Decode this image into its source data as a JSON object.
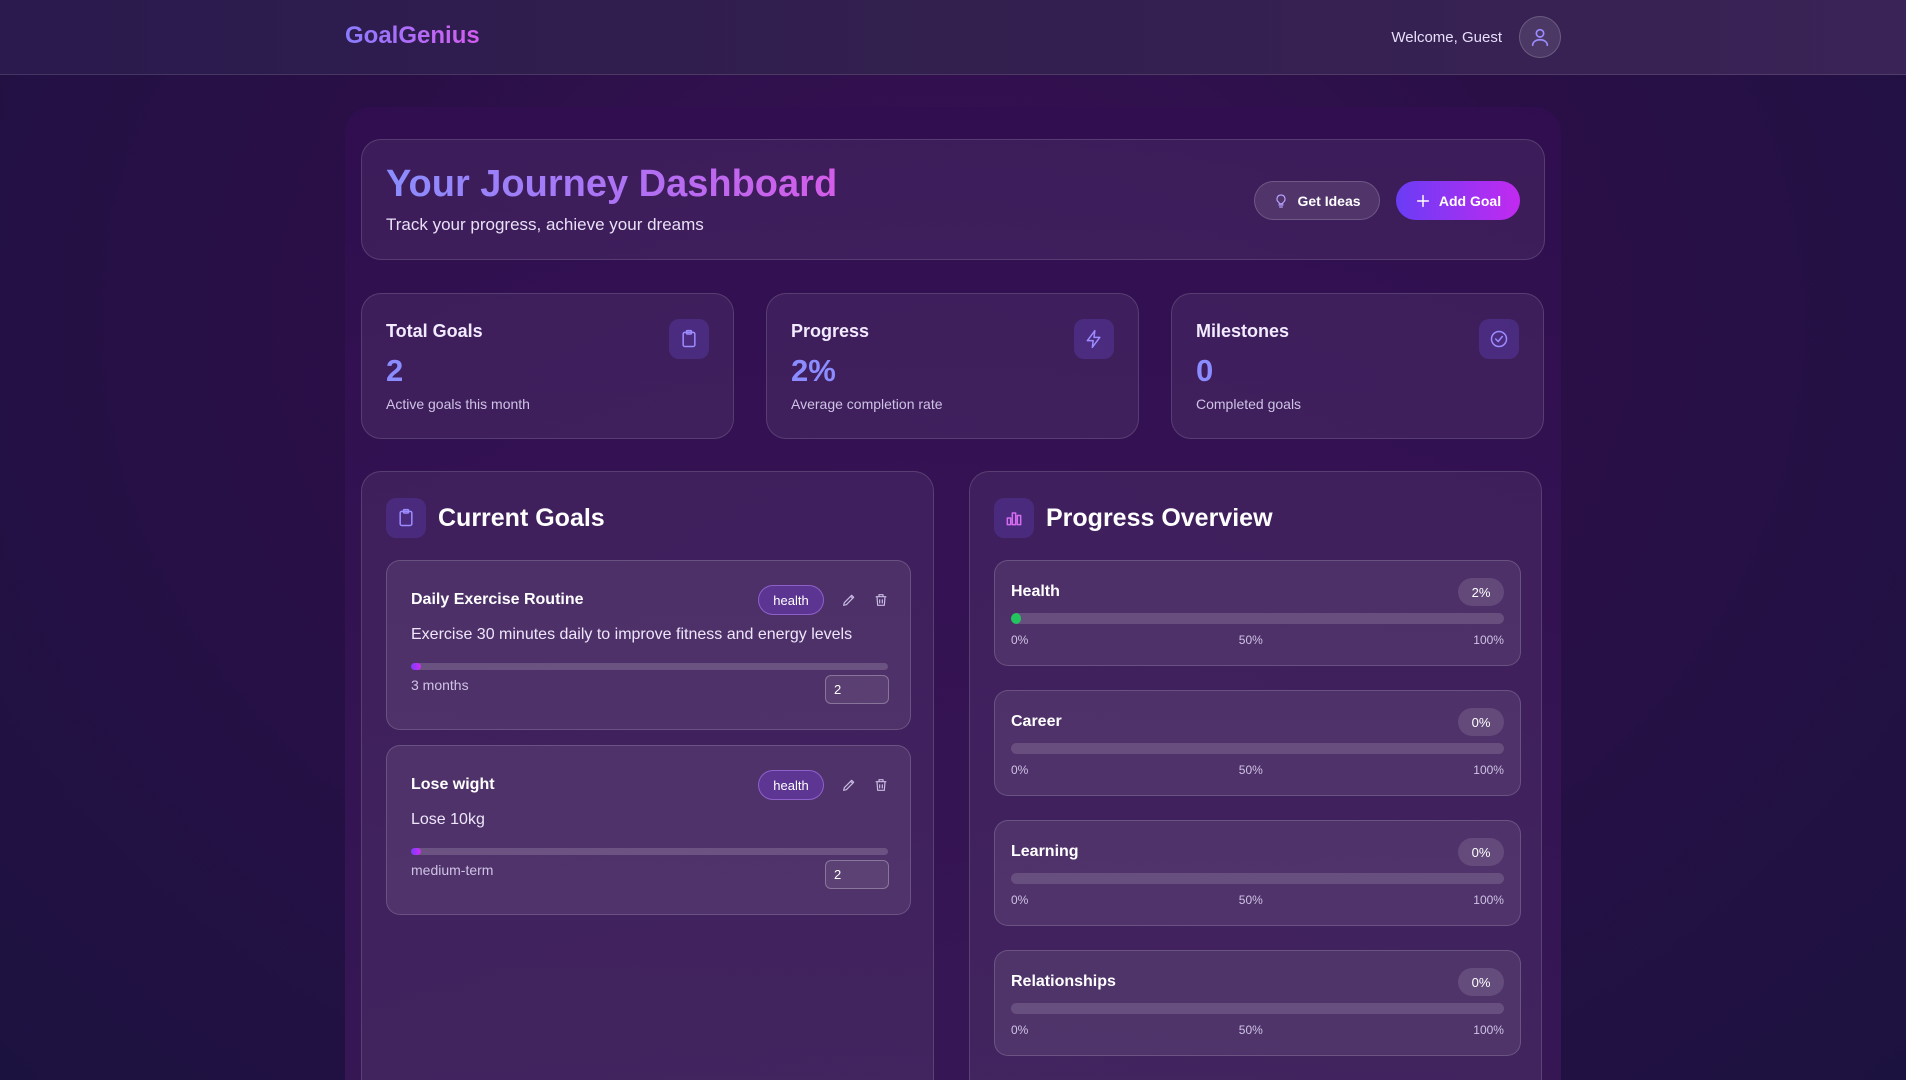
{
  "header": {
    "brand": "GoalGenius",
    "welcome": "Welcome, Guest",
    "avatar_icon": "user-icon"
  },
  "hero": {
    "title": "Your Journey Dashboard",
    "subtitle": "Track your progress, achieve your dreams",
    "ideas_label": "Get Ideas",
    "add_label": "Add Goal"
  },
  "stats": [
    {
      "title": "Total Goals",
      "value": "2",
      "note": "Active goals this month",
      "icon": "clipboard-icon"
    },
    {
      "title": "Progress",
      "value": "2%",
      "note": "Average completion rate",
      "icon": "lightning-icon"
    },
    {
      "title": "Milestones",
      "value": "0",
      "note": "Completed goals",
      "icon": "check-circle-icon"
    }
  ],
  "current_goals": {
    "title": "Current Goals",
    "icon": "clipboard-icon",
    "goals": [
      {
        "title": "Daily Exercise Routine",
        "tag": "health",
        "description": "Exercise 30 minutes daily to improve fitness and energy levels",
        "term": "3 months",
        "progress_value": "2",
        "progress_fraction": 0.02
      },
      {
        "title": "Lose wight",
        "tag": "health",
        "description": "Lose 10kg",
        "term": "medium-term",
        "progress_value": "2",
        "progress_fraction": 0.02
      }
    ]
  },
  "progress_overview": {
    "title": "Progress Overview",
    "icon": "bar-chart-icon",
    "scale": [
      "0%",
      "50%",
      "100%"
    ],
    "categories": [
      {
        "label": "Health",
        "percent": "2%",
        "fraction": 0.02
      },
      {
        "label": "Career",
        "percent": "0%",
        "fraction": 0
      },
      {
        "label": "Learning",
        "percent": "0%",
        "fraction": 0
      },
      {
        "label": "Relationships",
        "percent": "0%",
        "fraction": 0
      }
    ]
  },
  "colors": {
    "accent_start": "#6a3cf5",
    "accent_end": "#c22af0",
    "stat_value": "#8a8cff",
    "progress_green": "#22c55e"
  }
}
